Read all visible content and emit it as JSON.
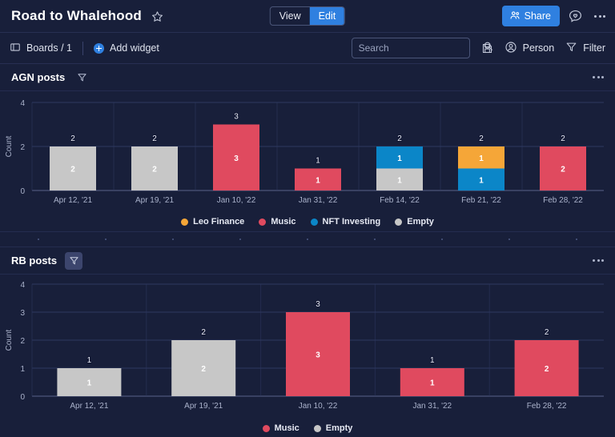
{
  "topbar": {
    "board_title": "Road to Whalehood",
    "star_icon": "star-outline-icon",
    "view_label": "View",
    "edit_label": "Edit",
    "active_segment": "Edit",
    "share_label": "Share",
    "share_icon": "people-icon",
    "chat_icon": "chat-heart-icon",
    "more_icon": "more-horizontal-icon",
    "accent_color": "#2f80e0"
  },
  "toolbar": {
    "boards_label": "Boards / 1",
    "boards_icon": "board-icon",
    "add_widget_label": "Add widget",
    "add_widget_icon": "plus-circle-icon",
    "search_placeholder": "Search",
    "search_value": "",
    "search_icon": "search-icon",
    "save_icon": "floppy-save-icon",
    "person_label": "Person",
    "person_icon": "person-circle-icon",
    "filter_label": "Filter",
    "filter_icon": "funnel-icon"
  },
  "colors": {
    "leo_finance": "#f5a638",
    "music": "#e04a5f",
    "nft_investing": "#0b86c8",
    "empty": "#c7c7c7",
    "background": "#181f3a",
    "gridline": "#2e3860",
    "axis_text": "#aab2cb"
  },
  "widgets": [
    {
      "title": "AGN posts",
      "filter_icon": "funnel-icon",
      "filter_active": false,
      "menu_icon": "more-horizontal-icon"
    },
    {
      "title": "RB posts",
      "filter_icon": "funnel-icon",
      "filter_active": true,
      "menu_icon": "more-horizontal-icon"
    }
  ],
  "chart_data": [
    {
      "type": "bar",
      "title": "AGN posts",
      "stacked": true,
      "xlabel": "",
      "ylabel": "Count",
      "ylim": [
        0,
        4
      ],
      "yticks": [
        0,
        2,
        4
      ],
      "grid": true,
      "legend_position": "bottom",
      "categories": [
        "Apr 12, '21",
        "Apr 19, '21",
        "Jan 10, '22",
        "Jan 31, '22",
        "Feb 14, '22",
        "Feb 21, '22",
        "Feb 28, '22"
      ],
      "series": [
        {
          "name": "Leo Finance",
          "color": "#f5a638",
          "values": [
            0,
            0,
            0,
            0,
            0,
            1,
            0
          ]
        },
        {
          "name": "Music",
          "color": "#e04a5f",
          "values": [
            0,
            0,
            3,
            1,
            0,
            0,
            2
          ]
        },
        {
          "name": "NFT Investing",
          "color": "#0b86c8",
          "values": [
            0,
            0,
            0,
            0,
            1,
            1,
            0
          ]
        },
        {
          "name": "Empty",
          "color": "#c7c7c7",
          "values": [
            2,
            2,
            0,
            0,
            1,
            0,
            0
          ]
        }
      ],
      "totals": [
        2,
        2,
        3,
        1,
        2,
        2,
        2
      ]
    },
    {
      "type": "bar",
      "title": "RB posts",
      "stacked": true,
      "xlabel": "",
      "ylabel": "Count",
      "ylim": [
        0,
        4
      ],
      "yticks": [
        0,
        1,
        2,
        3,
        4
      ],
      "grid": true,
      "legend_position": "bottom",
      "categories": [
        "Apr 12, '21",
        "Apr 19, '21",
        "Jan 10, '22",
        "Jan 31, '22",
        "Feb 28, '22"
      ],
      "series": [
        {
          "name": "Music",
          "color": "#e04a5f",
          "values": [
            0,
            0,
            3,
            1,
            2
          ]
        },
        {
          "name": "Empty",
          "color": "#c7c7c7",
          "values": [
            1,
            2,
            0,
            0,
            0
          ]
        }
      ],
      "totals": [
        1,
        2,
        3,
        1,
        2
      ]
    }
  ]
}
